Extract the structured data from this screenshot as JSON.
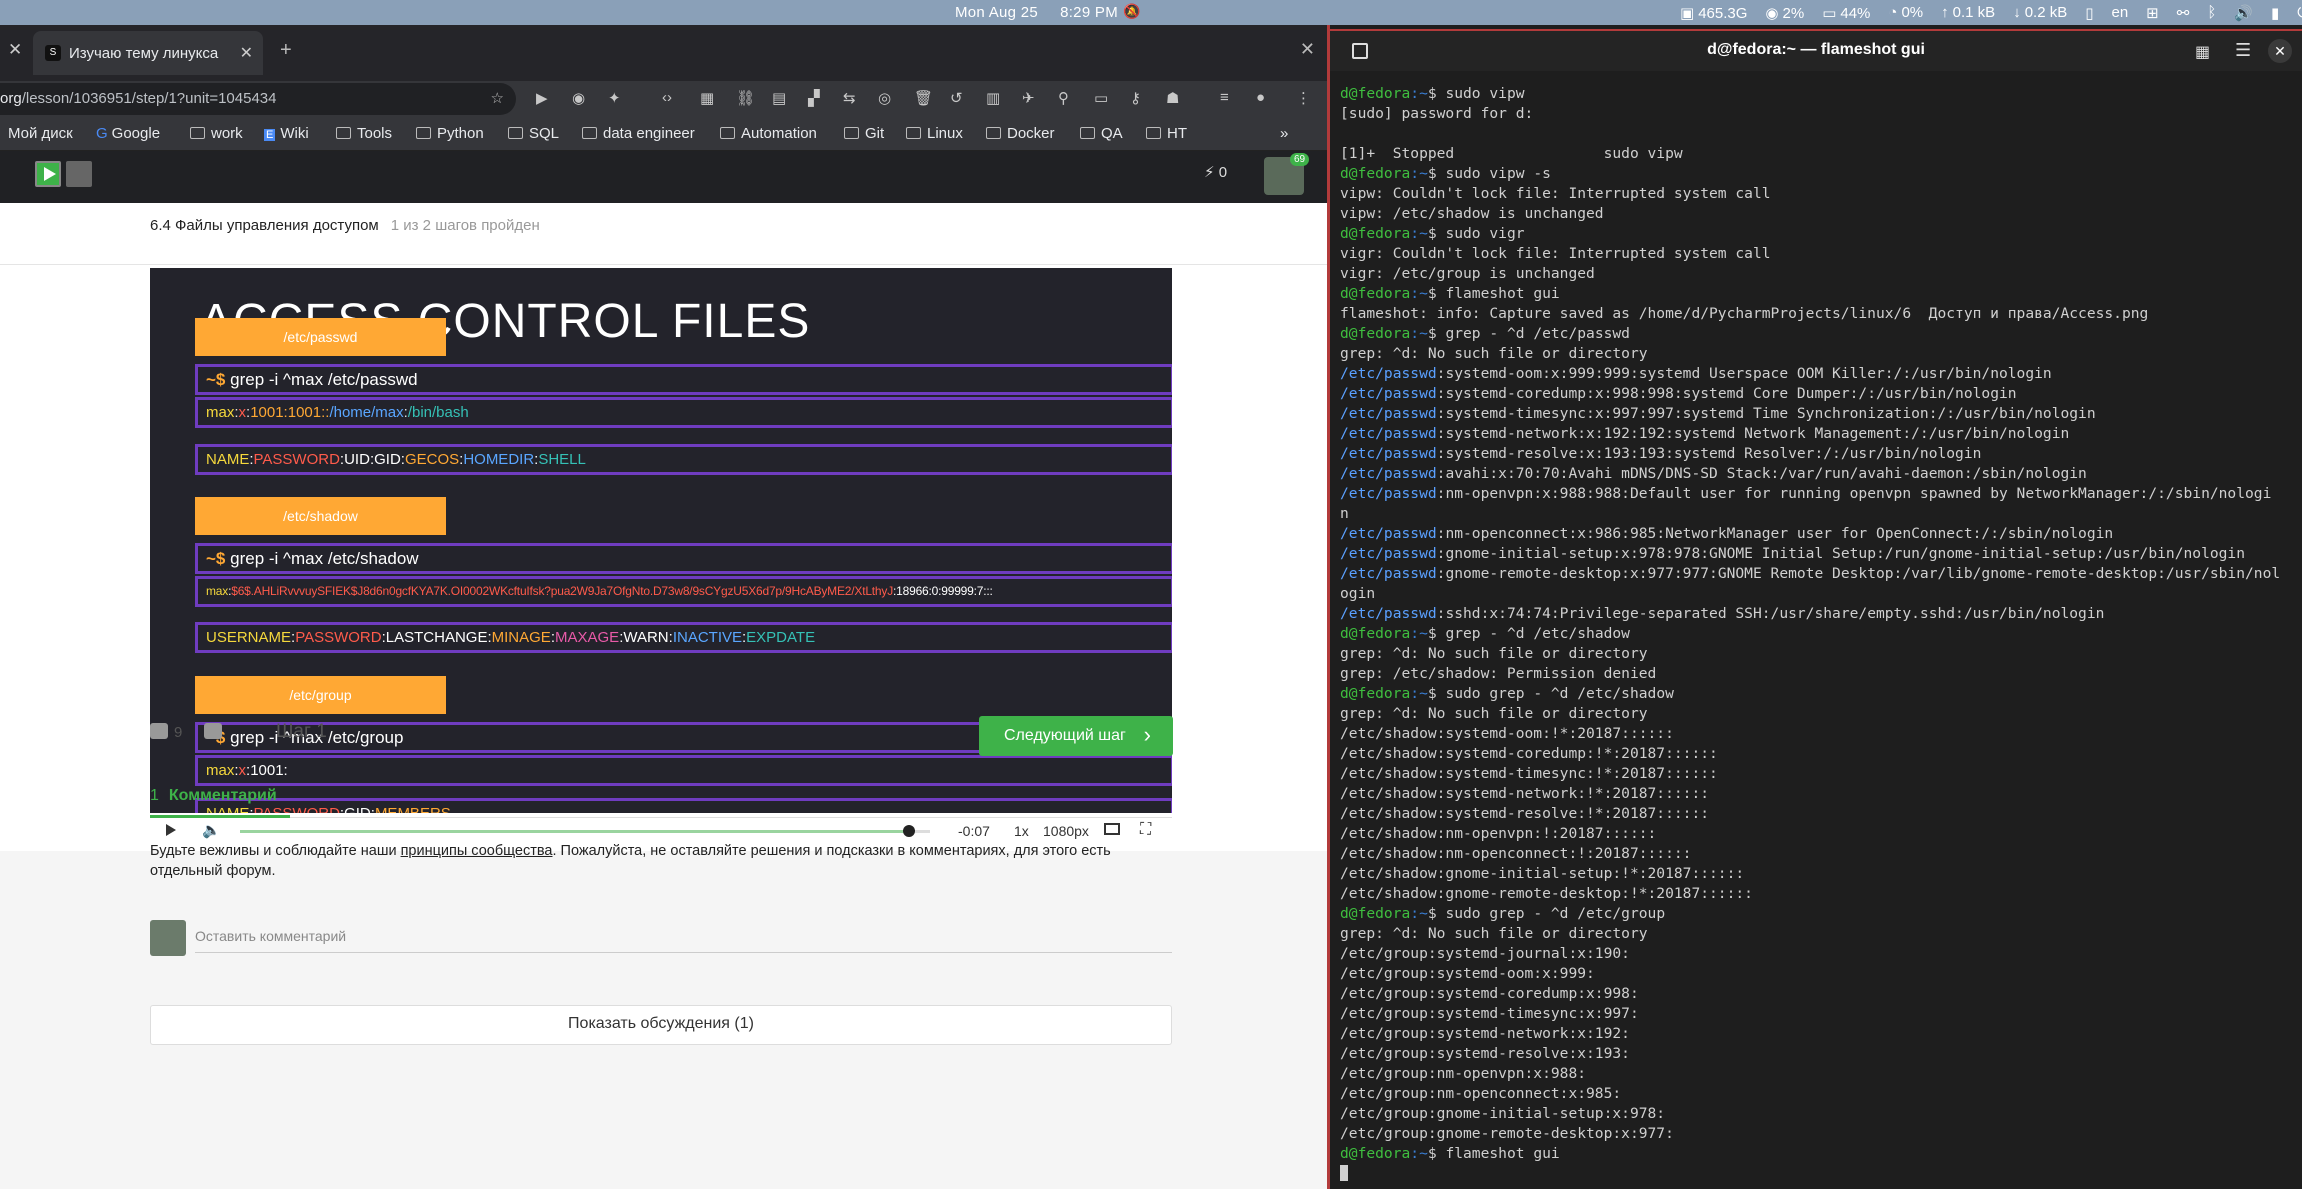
{
  "topbar": {
    "date": "Mon Aug 25",
    "time": "8:29 PM",
    "disk": "465.3G",
    "cpu": "2%",
    "mem": "44%",
    "swap": "0%",
    "net_up": "0.1 kB",
    "net_down": "0.2 kB",
    "lang": "en"
  },
  "browser": {
    "tab_title": "Изучаю тему линукса",
    "url_prefix": "org",
    "url_rest": "/lesson/1036951/step/1?unit=1045434",
    "bookmarks": [
      "Мой диск",
      "Google",
      "work",
      "Wiki",
      "Tools",
      "Python",
      "SQL",
      "data engineer",
      "Automation",
      "Git",
      "Linux",
      "Docker",
      "QA",
      "HT"
    ],
    "more": "»",
    "energy": "0",
    "avatar_badge": "69"
  },
  "lesson": {
    "breadcrumb": "6.4 Файлы управления доступом",
    "steps_done": "1 из 2 шагов пройден",
    "slide_title": "ACCESS CONTROL FILES",
    "tags": [
      "/etc/passwd",
      "/etc/shadow",
      "/etc/group"
    ],
    "prompt": "~$",
    "cmd_passwd": "grep  -i  ^max  /etc/passwd",
    "cmd_shadow": "grep  -i  ^max  /etc/shadow",
    "cmd_group": "grep  -i  ^max  /etc/group",
    "passwd_line": {
      "user": "max",
      "sep1": ":",
      "pw": "x",
      "sep2": ":",
      "ids": "1001:1001::",
      "home": "/home/max",
      "sep3": ":",
      "shell": "/bin/bash"
    },
    "passwd_fields": {
      "name": "NAME",
      "pw": "PASSWORD",
      "uid": "UID",
      "gid": "GID",
      "gecos": "GECOS",
      "home": "HOMEDIR",
      "shell": "SHELL"
    },
    "shadow_line": {
      "user": "max",
      "hash": "$6$.AHLiRvvvuySFIEK$J8d6n0gcfKYA7K.OI0002WKcftuIfsk?pua2W9Ja7OfgNto.D73w8/9sCYgzU5X6d7p/9HcAByME2/XtLthyJ",
      "rest": ":18966:0:99999:7:::"
    },
    "shadow_fields": {
      "name": "USERNAME",
      "pw": "PASSWORD",
      "last": "LASTCHANGE",
      "min": "MINAGE",
      "max": "MAXAGE",
      "warn": "WARN",
      "inactive": "INACTIVE",
      "exp": "EXPDATE"
    },
    "group_line": {
      "user": "max",
      "pw": "x",
      "gid": "1001:"
    },
    "group_fields": {
      "name": "NAME",
      "pw": "PASSWORD",
      "gid": "GID",
      "members": "MEMBERS"
    },
    "video": {
      "time": "-0:07",
      "speed": "1x",
      "quality": "1080px",
      "progress": 0.97
    },
    "likes": "9",
    "step_label": "Шаг 1",
    "next_label": "Следующий шаг",
    "comments_count": "1",
    "comments_tab": "Комментарий",
    "rules_pre": "Будьте вежливы и соблюдайте наши ",
    "rules_link": "принципы сообщества",
    "rules_post": ". Пожалуйста, не оставляйте решения и подсказки в комментариях, для этого есть отдельный форум.",
    "comment_placeholder": "Оставить комментарий",
    "show_discussions": "Показать обсуждения (1)"
  },
  "terminal": {
    "title": "d@fedora:~ — flameshot gui",
    "lines": [
      {
        "type": "prompt",
        "cmd": "sudo vipw"
      },
      {
        "type": "out",
        "text": "[sudo] password for d:"
      },
      {
        "type": "out",
        "text": ""
      },
      {
        "type": "out",
        "text": "[1]+  Stopped                 sudo vipw"
      },
      {
        "type": "prompt",
        "cmd": "sudo vipw -s"
      },
      {
        "type": "out",
        "text": "vipw: Couldn't lock file: Interrupted system call"
      },
      {
        "type": "out",
        "text": "vipw: /etc/shadow is unchanged"
      },
      {
        "type": "prompt",
        "cmd": "sudo vigr"
      },
      {
        "type": "out",
        "text": "vigr: Couldn't lock file: Interrupted system call"
      },
      {
        "type": "out",
        "text": "vigr: /etc/group is unchanged"
      },
      {
        "type": "prompt",
        "cmd": "flameshot gui"
      },
      {
        "type": "out",
        "text": "flameshot: info: Capture saved as /home/d/PycharmProjects/linux/6  Доступ и права/Access.png"
      },
      {
        "type": "prompt",
        "cmd": "grep - ^d /etc/passwd"
      },
      {
        "type": "out",
        "text": "grep: ^d: No such file or directory"
      },
      {
        "type": "pw",
        "text": "systemd-oom:x:999:999:systemd Userspace OOM Killer:/:/usr/bin/nologin"
      },
      {
        "type": "pw",
        "text": "systemd-coredump:x:998:998:systemd Core Dumper:/:/usr/bin/nologin"
      },
      {
        "type": "pw",
        "text": "systemd-timesync:x:997:997:systemd Time Synchronization:/:/usr/bin/nologin"
      },
      {
        "type": "pw",
        "text": "systemd-network:x:192:192:systemd Network Management:/:/usr/bin/nologin"
      },
      {
        "type": "pw",
        "text": "systemd-resolve:x:193:193:systemd Resolver:/:/usr/bin/nologin"
      },
      {
        "type": "pw",
        "text": "avahi:x:70:70:Avahi mDNS/DNS-SD Stack:/var/run/avahi-daemon:/sbin/nologin"
      },
      {
        "type": "pw",
        "text": "nm-openvpn:x:988:988:Default user for running openvpn spawned by NetworkManager:/:/sbin/nologi"
      },
      {
        "type": "out",
        "text": "n"
      },
      {
        "type": "pw",
        "text": "nm-openconnect:x:986:985:NetworkManager user for OpenConnect:/:/sbin/nologin"
      },
      {
        "type": "pw",
        "text": "gnome-initial-setup:x:978:978:GNOME Initial Setup:/run/gnome-initial-setup:/usr/bin/nologin"
      },
      {
        "type": "pw",
        "text": "gnome-remote-desktop:x:977:977:GNOME Remote Desktop:/var/lib/gnome-remote-desktop:/usr/sbin/nol"
      },
      {
        "type": "out",
        "text": "ogin"
      },
      {
        "type": "pw",
        "text": "sshd:x:74:74:Privilege-separated SSH:/usr/share/empty.sshd:/usr/bin/nologin"
      },
      {
        "type": "prompt",
        "cmd": "grep - ^d /etc/shadow"
      },
      {
        "type": "out",
        "text": "grep: ^d: No such file or directory"
      },
      {
        "type": "out",
        "text": "grep: /etc/shadow: Permission denied"
      },
      {
        "type": "prompt",
        "cmd": "sudo grep - ^d /etc/shadow"
      },
      {
        "type": "out",
        "text": "grep: ^d: No such file or directory"
      },
      {
        "type": "out",
        "text": "/etc/shadow:systemd-oom:!*:20187::::::"
      },
      {
        "type": "out",
        "text": "/etc/shadow:systemd-coredump:!*:20187::::::"
      },
      {
        "type": "out",
        "text": "/etc/shadow:systemd-timesync:!*:20187::::::"
      },
      {
        "type": "out",
        "text": "/etc/shadow:systemd-network:!*:20187::::::"
      },
      {
        "type": "out",
        "text": "/etc/shadow:systemd-resolve:!*:20187::::::"
      },
      {
        "type": "out",
        "text": "/etc/shadow:nm-openvpn:!:20187::::::"
      },
      {
        "type": "out",
        "text": "/etc/shadow:nm-openconnect:!:20187::::::"
      },
      {
        "type": "out",
        "text": "/etc/shadow:gnome-initial-setup:!*:20187::::::"
      },
      {
        "type": "out",
        "text": "/etc/shadow:gnome-remote-desktop:!*:20187::::::"
      },
      {
        "type": "prompt",
        "cmd": "sudo grep - ^d /etc/group"
      },
      {
        "type": "out",
        "text": "grep: ^d: No such file or directory"
      },
      {
        "type": "out",
        "text": "/etc/group:systemd-journal:x:190:"
      },
      {
        "type": "out",
        "text": "/etc/group:systemd-oom:x:999:"
      },
      {
        "type": "out",
        "text": "/etc/group:systemd-coredump:x:998:"
      },
      {
        "type": "out",
        "text": "/etc/group:systemd-timesync:x:997:"
      },
      {
        "type": "out",
        "text": "/etc/group:systemd-network:x:192:"
      },
      {
        "type": "out",
        "text": "/etc/group:systemd-resolve:x:193:"
      },
      {
        "type": "out",
        "text": "/etc/group:nm-openvpn:x:988:"
      },
      {
        "type": "out",
        "text": "/etc/group:nm-openconnect:x:985:"
      },
      {
        "type": "out",
        "text": "/etc/group:gnome-initial-setup:x:978:"
      },
      {
        "type": "out",
        "text": "/etc/group:gnome-remote-desktop:x:977:"
      },
      {
        "type": "prompt",
        "cmd": "flameshot gui"
      },
      {
        "type": "cursor",
        "text": ""
      }
    ],
    "prompt_user": "d@fedora",
    "prompt_path": ":~",
    "prompt_sym": "$ ",
    "pw_prefix": "/etc/passwd"
  },
  "colors": {
    "accent": "#3eb249",
    "slide_tag": "#ffa834",
    "slide_border": "#6f3cc0",
    "term_border": "#b23b3b"
  }
}
